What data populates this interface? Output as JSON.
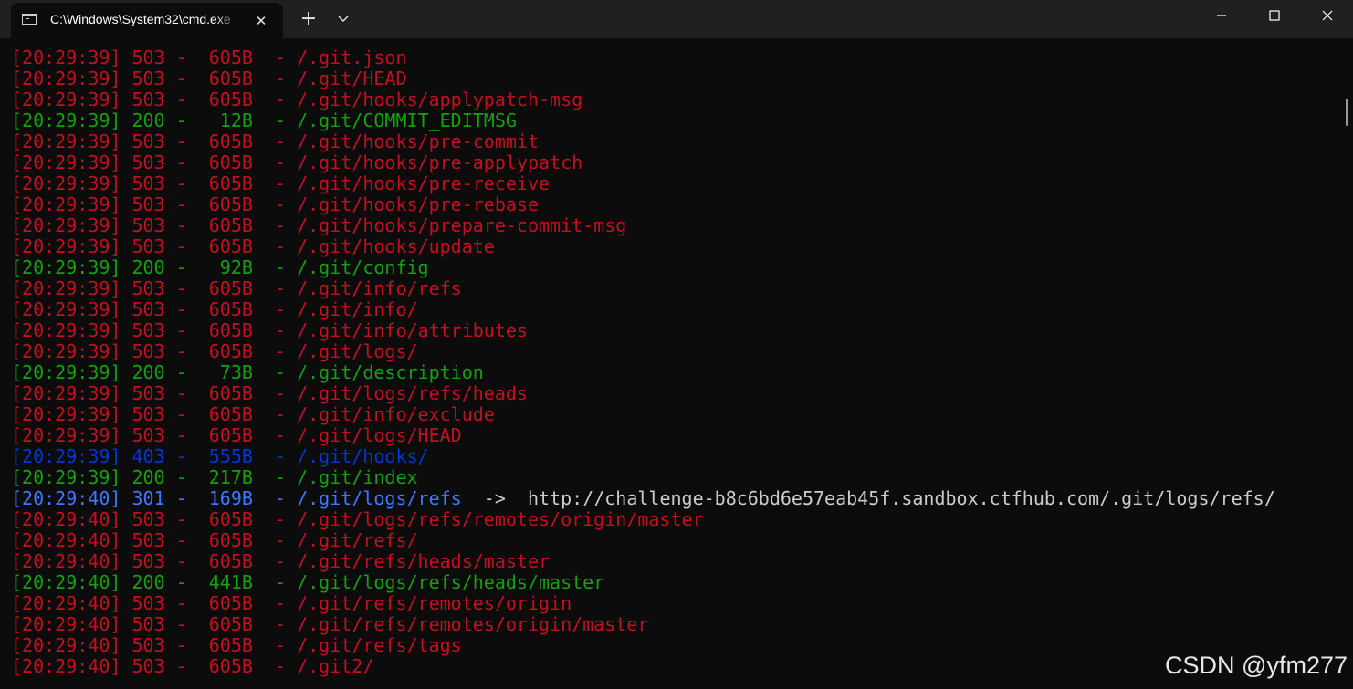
{
  "window": {
    "tab_title": "C:\\Windows\\System32\\cmd.exe",
    "tab_close": "✕",
    "new_tab": "+"
  },
  "colors": {
    "red": "#c50f1f",
    "green": "#13a10e",
    "blue": "#0037da",
    "lightblue": "#3b78ff",
    "redirect_target": "#cccccc"
  },
  "lines": [
    {
      "time": "[20:29:39]",
      "status": "503",
      "size": " 605B",
      "path": "/.git.json",
      "color": "red"
    },
    {
      "time": "[20:29:39]",
      "status": "503",
      "size": " 605B",
      "path": "/.git/HEAD",
      "color": "red"
    },
    {
      "time": "[20:29:39]",
      "status": "503",
      "size": " 605B",
      "path": "/.git/hooks/applypatch-msg",
      "color": "red"
    },
    {
      "time": "[20:29:39]",
      "status": "200",
      "size": "  12B",
      "path": "/.git/COMMIT_EDITMSG",
      "color": "green"
    },
    {
      "time": "[20:29:39]",
      "status": "503",
      "size": " 605B",
      "path": "/.git/hooks/pre-commit",
      "color": "red"
    },
    {
      "time": "[20:29:39]",
      "status": "503",
      "size": " 605B",
      "path": "/.git/hooks/pre-applypatch",
      "color": "red"
    },
    {
      "time": "[20:29:39]",
      "status": "503",
      "size": " 605B",
      "path": "/.git/hooks/pre-receive",
      "color": "red"
    },
    {
      "time": "[20:29:39]",
      "status": "503",
      "size": " 605B",
      "path": "/.git/hooks/pre-rebase",
      "color": "red"
    },
    {
      "time": "[20:29:39]",
      "status": "503",
      "size": " 605B",
      "path": "/.git/hooks/prepare-commit-msg",
      "color": "red"
    },
    {
      "time": "[20:29:39]",
      "status": "503",
      "size": " 605B",
      "path": "/.git/hooks/update",
      "color": "red"
    },
    {
      "time": "[20:29:39]",
      "status": "200",
      "size": "  92B",
      "path": "/.git/config",
      "color": "green"
    },
    {
      "time": "[20:29:39]",
      "status": "503",
      "size": " 605B",
      "path": "/.git/info/refs",
      "color": "red"
    },
    {
      "time": "[20:29:39]",
      "status": "503",
      "size": " 605B",
      "path": "/.git/info/",
      "color": "red"
    },
    {
      "time": "[20:29:39]",
      "status": "503",
      "size": " 605B",
      "path": "/.git/info/attributes",
      "color": "red"
    },
    {
      "time": "[20:29:39]",
      "status": "503",
      "size": " 605B",
      "path": "/.git/logs/",
      "color": "red"
    },
    {
      "time": "[20:29:39]",
      "status": "200",
      "size": "  73B",
      "path": "/.git/description",
      "color": "green"
    },
    {
      "time": "[20:29:39]",
      "status": "503",
      "size": " 605B",
      "path": "/.git/logs/refs/heads",
      "color": "red"
    },
    {
      "time": "[20:29:39]",
      "status": "503",
      "size": " 605B",
      "path": "/.git/info/exclude",
      "color": "red"
    },
    {
      "time": "[20:29:39]",
      "status": "503",
      "size": " 605B",
      "path": "/.git/logs/HEAD",
      "color": "red"
    },
    {
      "time": "[20:29:39]",
      "status": "403",
      "size": " 555B",
      "path": "/.git/hooks/",
      "color": "blue"
    },
    {
      "time": "[20:29:39]",
      "status": "200",
      "size": " 217B",
      "path": "/.git/index",
      "color": "green"
    },
    {
      "time": "[20:29:40]",
      "status": "301",
      "size": " 169B",
      "path": "/.git/logs/refs",
      "color": "lightblue",
      "redirect": "  ->  http://challenge-b8c6bd6e57eab45f.sandbox.ctfhub.com/.git/logs/refs/"
    },
    {
      "time": "[20:29:40]",
      "status": "503",
      "size": " 605B",
      "path": "/.git/logs/refs/remotes/origin/master",
      "color": "red"
    },
    {
      "time": "[20:29:40]",
      "status": "503",
      "size": " 605B",
      "path": "/.git/refs/",
      "color": "red"
    },
    {
      "time": "[20:29:40]",
      "status": "503",
      "size": " 605B",
      "path": "/.git/refs/heads/master",
      "color": "red"
    },
    {
      "time": "[20:29:40]",
      "status": "200",
      "size": " 441B",
      "path": "/.git/logs/refs/heads/master",
      "color": "green"
    },
    {
      "time": "[20:29:40]",
      "status": "503",
      "size": " 605B",
      "path": "/.git/refs/remotes/origin",
      "color": "red"
    },
    {
      "time": "[20:29:40]",
      "status": "503",
      "size": " 605B",
      "path": "/.git/refs/remotes/origin/master",
      "color": "red"
    },
    {
      "time": "[20:29:40]",
      "status": "503",
      "size": " 605B",
      "path": "/.git/refs/tags",
      "color": "red"
    },
    {
      "time": "[20:29:40]",
      "status": "503",
      "size": " 605B",
      "path": "/.git2/",
      "color": "red"
    }
  ],
  "watermark": "CSDN @yfm277"
}
